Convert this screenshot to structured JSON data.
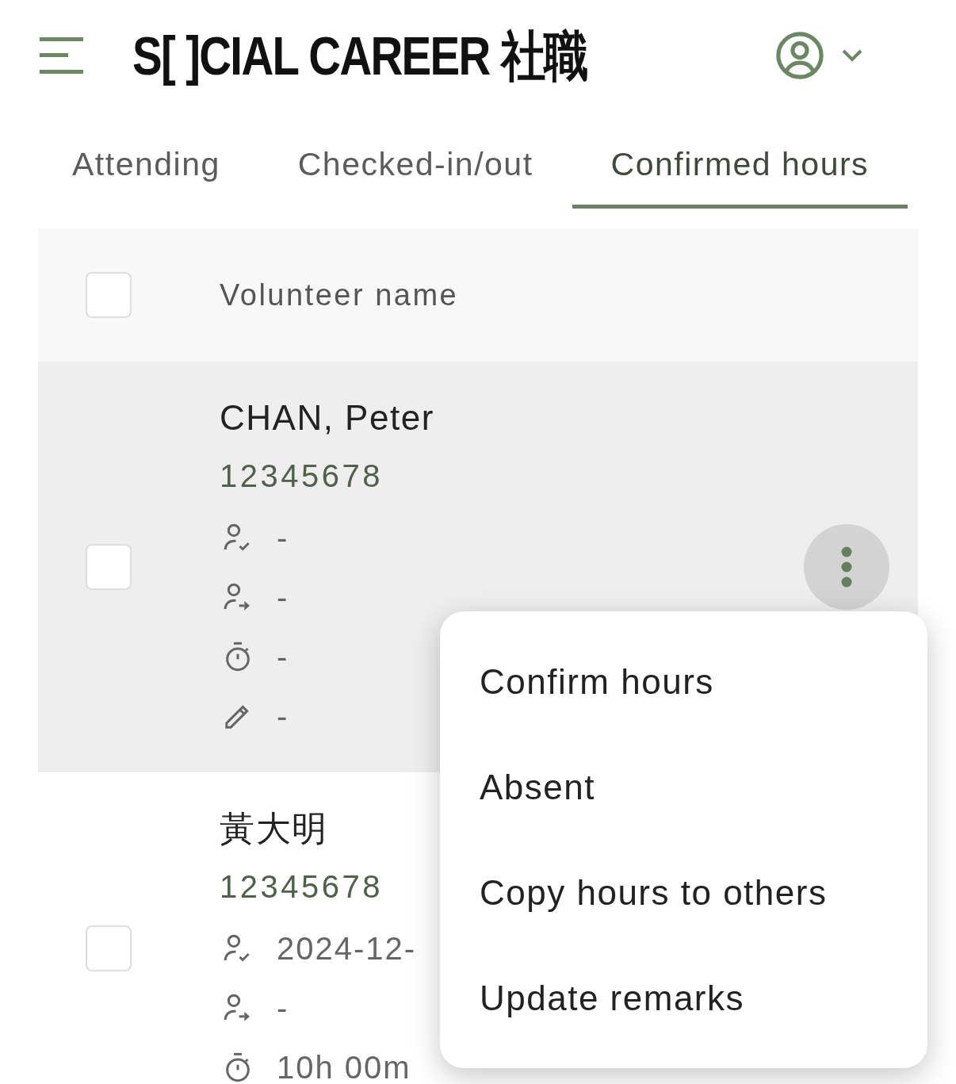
{
  "header": {
    "logo": "S[ ]CIAL CAREER 社職"
  },
  "tabs": [
    {
      "label": "Attending",
      "selected": false
    },
    {
      "label": "Checked-in/out",
      "selected": false
    },
    {
      "label": "Confirmed hours",
      "selected": true
    }
  ],
  "table": {
    "select_all": {
      "checked": false
    },
    "column": "Volunteer name",
    "rows": [
      {
        "name": "CHAN, Peter",
        "id": "12345678",
        "checked": false,
        "highlighted": true,
        "details": [
          {
            "kind": "checked_in",
            "value": "-"
          },
          {
            "kind": "checked_out",
            "value": "-"
          },
          {
            "kind": "duration",
            "value": "-"
          },
          {
            "kind": "remarks",
            "value": "-"
          }
        ]
      },
      {
        "name": "黃大明",
        "id": "12345678",
        "checked": false,
        "highlighted": false,
        "details": [
          {
            "kind": "checked_in",
            "value": "2024-12-"
          },
          {
            "kind": "checked_out",
            "value": "-"
          },
          {
            "kind": "duration",
            "value": "10h 00m"
          }
        ]
      }
    ]
  },
  "menu": {
    "items": [
      "Confirm hours",
      "Absent",
      "Copy hours to others",
      "Update remarks"
    ]
  }
}
